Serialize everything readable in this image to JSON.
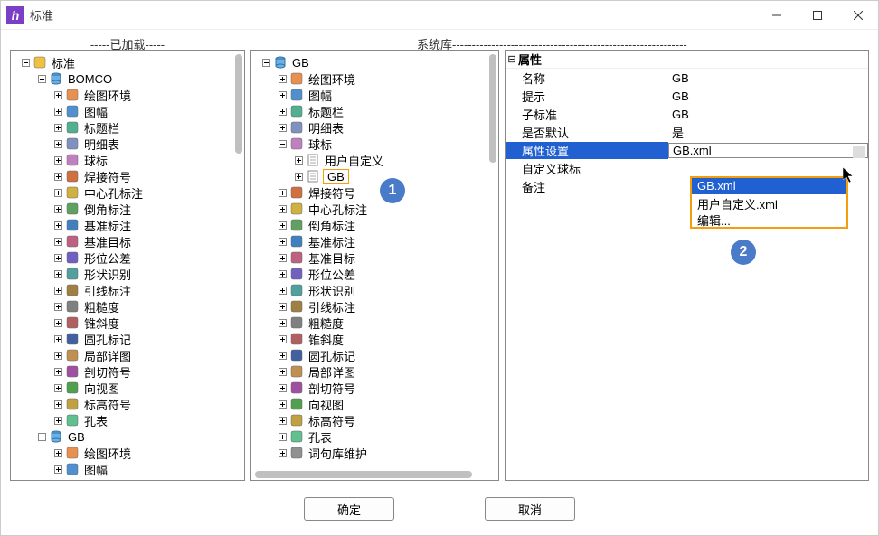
{
  "window": {
    "title": "标准"
  },
  "headers": {
    "left": "-----已加载-----",
    "right": "系统库------------------------------------------------------------"
  },
  "left_tree": [
    {
      "depth": 0,
      "exp": "minus",
      "icon": "folder-edit",
      "label": "标准"
    },
    {
      "depth": 1,
      "exp": "minus",
      "icon": "db",
      "label": "BOMCO"
    },
    {
      "depth": 2,
      "exp": "plus",
      "icon": "draw",
      "label": "绘图环境"
    },
    {
      "depth": 2,
      "exp": "plus",
      "icon": "frame",
      "label": "图幅"
    },
    {
      "depth": 2,
      "exp": "plus",
      "icon": "title",
      "label": "标题栏"
    },
    {
      "depth": 2,
      "exp": "plus",
      "icon": "table",
      "label": "明细表"
    },
    {
      "depth": 2,
      "exp": "plus",
      "icon": "ball",
      "label": "球标"
    },
    {
      "depth": 2,
      "exp": "plus",
      "icon": "weld",
      "label": "焊接符号"
    },
    {
      "depth": 2,
      "exp": "plus",
      "icon": "center",
      "label": "中心孔标注"
    },
    {
      "depth": 2,
      "exp": "plus",
      "icon": "chamfer",
      "label": "倒角标注"
    },
    {
      "depth": 2,
      "exp": "plus",
      "icon": "datum",
      "label": "基准标注"
    },
    {
      "depth": 2,
      "exp": "plus",
      "icon": "target",
      "label": "基准目标"
    },
    {
      "depth": 2,
      "exp": "plus",
      "icon": "geotol",
      "label": "形位公差"
    },
    {
      "depth": 2,
      "exp": "plus",
      "icon": "shape",
      "label": "形状识别"
    },
    {
      "depth": 2,
      "exp": "plus",
      "icon": "leader",
      "label": "引线标注"
    },
    {
      "depth": 2,
      "exp": "plus",
      "icon": "rough",
      "label": "粗糙度"
    },
    {
      "depth": 2,
      "exp": "plus",
      "icon": "taper",
      "label": "锥斜度"
    },
    {
      "depth": 2,
      "exp": "plus",
      "icon": "hole",
      "label": "圆孔标记"
    },
    {
      "depth": 2,
      "exp": "plus",
      "icon": "detail",
      "label": "局部详图"
    },
    {
      "depth": 2,
      "exp": "plus",
      "icon": "section",
      "label": "剖切符号"
    },
    {
      "depth": 2,
      "exp": "plus",
      "icon": "view",
      "label": "向视图"
    },
    {
      "depth": 2,
      "exp": "plus",
      "icon": "elev",
      "label": "标高符号"
    },
    {
      "depth": 2,
      "exp": "plus",
      "icon": "holetbl",
      "label": "孔表"
    },
    {
      "depth": 1,
      "exp": "minus",
      "icon": "db",
      "label": "GB"
    },
    {
      "depth": 2,
      "exp": "plus",
      "icon": "draw",
      "label": "绘图环境"
    },
    {
      "depth": 2,
      "exp": "plus",
      "icon": "frame",
      "label": "图幅"
    }
  ],
  "mid_tree": [
    {
      "depth": 0,
      "exp": "minus",
      "icon": "db",
      "label": "GB"
    },
    {
      "depth": 1,
      "exp": "plus",
      "icon": "draw",
      "label": "绘图环境"
    },
    {
      "depth": 1,
      "exp": "plus",
      "icon": "frame",
      "label": "图幅"
    },
    {
      "depth": 1,
      "exp": "plus",
      "icon": "title",
      "label": "标题栏"
    },
    {
      "depth": 1,
      "exp": "plus",
      "icon": "table",
      "label": "明细表"
    },
    {
      "depth": 1,
      "exp": "minus",
      "icon": "ball",
      "label": "球标"
    },
    {
      "depth": 2,
      "exp": "plus",
      "icon": "doc",
      "label": "用户自定义"
    },
    {
      "depth": 2,
      "exp": "plus",
      "icon": "doc",
      "label": "GB",
      "selected": true
    },
    {
      "depth": 1,
      "exp": "plus",
      "icon": "weld",
      "label": "焊接符号"
    },
    {
      "depth": 1,
      "exp": "plus",
      "icon": "center",
      "label": "中心孔标注"
    },
    {
      "depth": 1,
      "exp": "plus",
      "icon": "chamfer",
      "label": "倒角标注"
    },
    {
      "depth": 1,
      "exp": "plus",
      "icon": "datum",
      "label": "基准标注"
    },
    {
      "depth": 1,
      "exp": "plus",
      "icon": "target",
      "label": "基准目标"
    },
    {
      "depth": 1,
      "exp": "plus",
      "icon": "geotol",
      "label": "形位公差"
    },
    {
      "depth": 1,
      "exp": "plus",
      "icon": "shape",
      "label": "形状识别"
    },
    {
      "depth": 1,
      "exp": "plus",
      "icon": "leader",
      "label": "引线标注"
    },
    {
      "depth": 1,
      "exp": "plus",
      "icon": "rough",
      "label": "粗糙度"
    },
    {
      "depth": 1,
      "exp": "plus",
      "icon": "taper",
      "label": "锥斜度"
    },
    {
      "depth": 1,
      "exp": "plus",
      "icon": "hole",
      "label": "圆孔标记"
    },
    {
      "depth": 1,
      "exp": "plus",
      "icon": "detail",
      "label": "局部详图"
    },
    {
      "depth": 1,
      "exp": "plus",
      "icon": "section",
      "label": "剖切符号"
    },
    {
      "depth": 1,
      "exp": "plus",
      "icon": "view",
      "label": "向视图"
    },
    {
      "depth": 1,
      "exp": "plus",
      "icon": "elev",
      "label": "标高符号"
    },
    {
      "depth": 1,
      "exp": "plus",
      "icon": "holetbl",
      "label": "孔表"
    },
    {
      "depth": 1,
      "exp": "plus",
      "icon": "maint",
      "label": "词句库维护"
    }
  ],
  "props": {
    "title": "属性",
    "rows": [
      {
        "label": "名称",
        "value": "GB"
      },
      {
        "label": "提示",
        "value": "GB"
      },
      {
        "label": "子标准",
        "value": "GB"
      },
      {
        "label": "是否默认",
        "value": "是"
      },
      {
        "label": "属性设置",
        "value": "GB.xml",
        "selected": true
      },
      {
        "label": "自定义球标",
        "value": ""
      },
      {
        "label": "备注",
        "value": ""
      }
    ]
  },
  "dropdown": {
    "items": [
      {
        "label": "GB.xml",
        "hl": true
      },
      {
        "label": "用户自定义.xml"
      },
      {
        "label": "编辑..."
      }
    ]
  },
  "badges": {
    "one": "1",
    "two": "2"
  },
  "buttons": {
    "ok": "确定",
    "cancel": "取消"
  }
}
